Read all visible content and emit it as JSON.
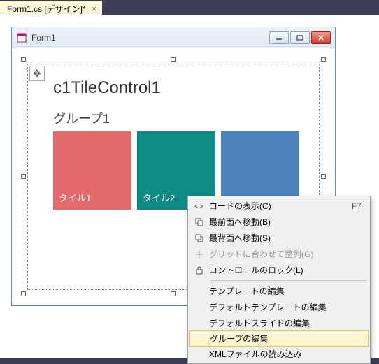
{
  "tab": {
    "label": "Form1.cs [デザイン]*"
  },
  "window": {
    "title": "Form1"
  },
  "control": {
    "title": "c1TileControl1",
    "group_label": "グループ1",
    "tiles": [
      {
        "label": "タイル1",
        "color": "#e56a6d"
      },
      {
        "label": "タイル2",
        "color": "#0f8b86"
      },
      {
        "label": "",
        "color": "#4b83bc"
      }
    ]
  },
  "context_menu": {
    "items": [
      {
        "icon": "code",
        "label": "コードの表示(C)",
        "shortcut": "F7"
      },
      {
        "icon": "bring-front",
        "label": "最前面へ移動(B)",
        "shortcut": ""
      },
      {
        "icon": "send-back",
        "label": "最背面へ移動(S)",
        "shortcut": ""
      },
      {
        "icon": "align-grid",
        "label": "グリッドに合わせて整列(G)",
        "shortcut": "",
        "disabled": true
      },
      {
        "icon": "lock",
        "label": "コントロールのロック(L)",
        "shortcut": ""
      }
    ],
    "items2": [
      {
        "label": "テンプレートの編集"
      },
      {
        "label": "デフォルトテンプレートの編集"
      },
      {
        "label": "デフォルトスライドの編集"
      },
      {
        "label": "グループの編集",
        "highlight": true
      },
      {
        "label": "XMLファイルの読み込み"
      }
    ]
  }
}
